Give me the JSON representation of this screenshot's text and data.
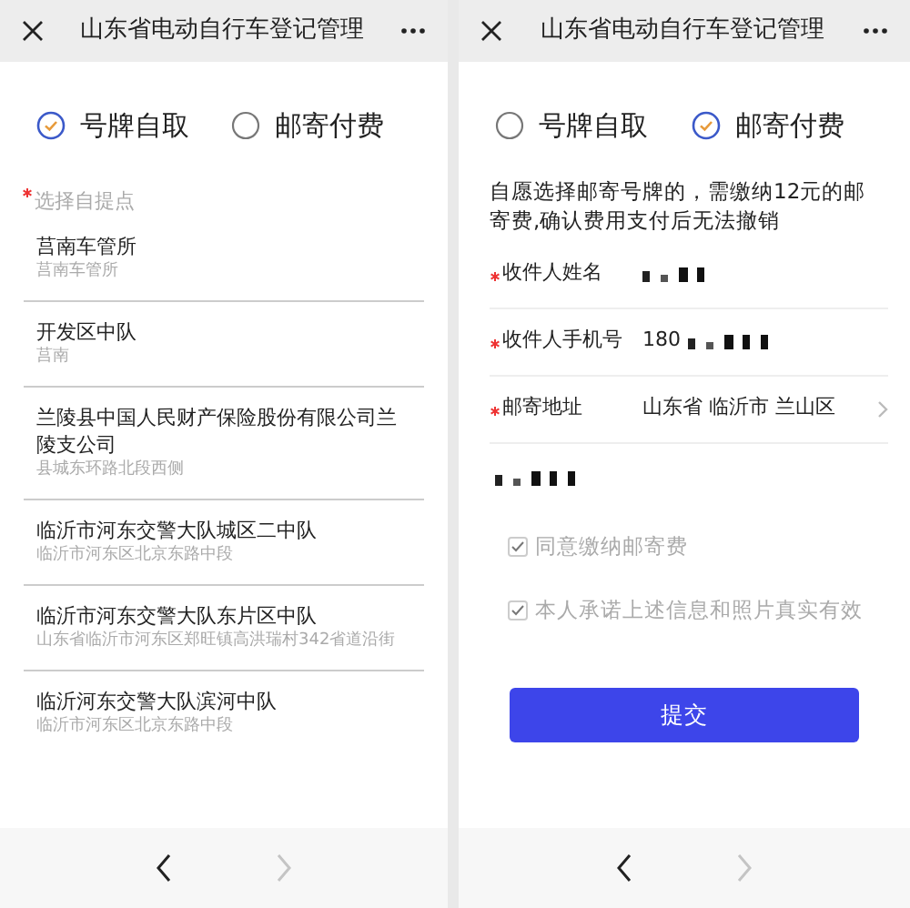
{
  "left_screen": {
    "header": {
      "title": "山东省电动自行车登记管理"
    },
    "options": [
      {
        "label": "号牌自取",
        "selected": true
      },
      {
        "label": "邮寄付费",
        "selected": false
      }
    ],
    "pickup_label": {
      "text": "选择自提点",
      "required": true
    },
    "pickup_points": [
      {
        "name": "莒南车管所",
        "address": "莒南车管所"
      },
      {
        "name": "开发区中队",
        "address": "莒南"
      },
      {
        "name": "兰陵县中国人民财产保险股份有限公司兰陵支公司",
        "address": "县城东环路北段西侧"
      },
      {
        "name": "临沂市河东交警大队城区二中队",
        "address": "临沂市河东区北京东路中段"
      },
      {
        "name": "临沂市河东交警大队东片区中队",
        "address": "山东省临沂市河东区郑旺镇高洪瑞村342省道沿街"
      },
      {
        "name": "临沂河东交警大队滨河中队",
        "address": "临沂市河东区北京东路中段"
      }
    ],
    "nav": {
      "back_disabled": false,
      "forward_disabled": true
    }
  },
  "right_screen": {
    "header": {
      "title": "山东省电动自行车登记管理"
    },
    "options": [
      {
        "label": "号牌自取",
        "selected": false
      },
      {
        "label": "邮寄付费",
        "selected": true
      }
    ],
    "notice": "自愿选择邮寄号牌的，需缴纳12元的邮寄费,确认费用支付后无法撤销",
    "fields": [
      {
        "label": "收件人姓名",
        "required": true,
        "redacted": true,
        "chevron": false
      },
      {
        "label": "收件人手机号",
        "required": true,
        "value": "180",
        "redacted": true,
        "chevron": false
      },
      {
        "label": "邮寄地址",
        "required": true,
        "value": "山东省 临沂市 兰山区",
        "redacted": false,
        "chevron": true
      }
    ],
    "detail_redacted": true,
    "agreements": [
      {
        "label": "同意缴纳邮寄费",
        "checked": true
      },
      {
        "label": "本人承诺上述信息和照片真实有效",
        "checked": true
      }
    ],
    "submit": "提交",
    "nav": {
      "back_disabled": false,
      "forward_disabled": true
    }
  }
}
